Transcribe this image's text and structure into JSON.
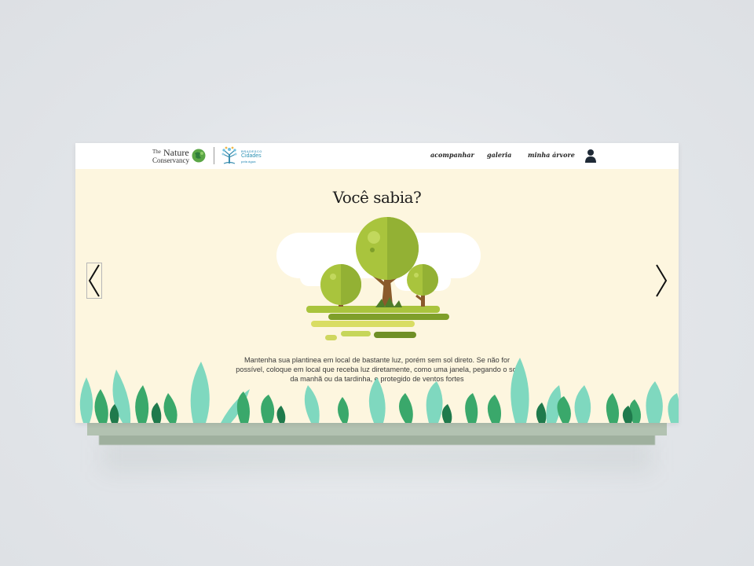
{
  "brand": {
    "tnc": {
      "the": "The",
      "nature": "Nature",
      "conservancy": "Conservancy"
    },
    "partner": {
      "line1": "BRADESCO",
      "line2": "Cidades",
      "line3": "pela água"
    }
  },
  "nav": {
    "links": [
      "acompanhar",
      "galeria",
      "minha árvore"
    ],
    "user_icon": "user-icon"
  },
  "slide": {
    "title": "Você sabia?",
    "text": "Mantenha sua plantinea em local de bastante luz, porém sem sol direto. Se não for possível, coloque em local que receba luz diretamente, como uma janela, pegando o sol da manhã ou da tardinha, e protegido de ventos fortes"
  },
  "colors": {
    "card_bg": "#fdf6df",
    "navbar_bg": "#ffffff",
    "tree_light": "#a9c43d",
    "tree_dark": "#7f9f2a",
    "trunk": "#8a5a2b",
    "leaf_mint": "#7fd8bf",
    "leaf_green": "#3aa86b"
  }
}
